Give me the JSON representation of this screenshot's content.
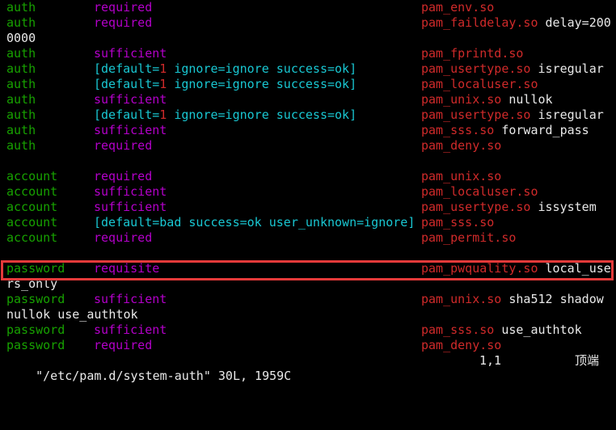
{
  "colors": {
    "type": "#17a100",
    "control": "#b300c9",
    "bracket": "#19c7d2",
    "module": "#cf2a2a",
    "args": "#e9e9e9",
    "highlight": "#e53a3a",
    "background": "#000000"
  },
  "lines": [
    {
      "kind": "rule",
      "type": "auth",
      "control": [
        {
          "t": "required",
          "c": "purple"
        }
      ],
      "module": "pam_env.so",
      "args": ""
    },
    {
      "kind": "rule",
      "type": "auth",
      "control": [
        {
          "t": "required",
          "c": "purple"
        }
      ],
      "module": "pam_faildelay.so",
      "args": " delay=200"
    },
    {
      "kind": "wrap",
      "text": "0000"
    },
    {
      "kind": "rule",
      "type": "auth",
      "control": [
        {
          "t": "sufficient",
          "c": "purple"
        }
      ],
      "module": "pam_fprintd.so",
      "args": ""
    },
    {
      "kind": "rule",
      "type": "auth",
      "control": [
        {
          "t": "[default=",
          "c": "cyan"
        },
        {
          "t": "1",
          "c": "red"
        },
        {
          "t": " ignore=ignore success=ok]",
          "c": "cyan"
        }
      ],
      "module": "pam_usertype.so",
      "args": " isregular"
    },
    {
      "kind": "rule",
      "type": "auth",
      "control": [
        {
          "t": "[default=",
          "c": "cyan"
        },
        {
          "t": "1",
          "c": "red"
        },
        {
          "t": " ignore=ignore success=ok]",
          "c": "cyan"
        }
      ],
      "module": "pam_localuser.so",
      "args": ""
    },
    {
      "kind": "rule",
      "type": "auth",
      "control": [
        {
          "t": "sufficient",
          "c": "purple"
        }
      ],
      "module": "pam_unix.so",
      "args": " nullok"
    },
    {
      "kind": "rule",
      "type": "auth",
      "control": [
        {
          "t": "[default=",
          "c": "cyan"
        },
        {
          "t": "1",
          "c": "red"
        },
        {
          "t": " ignore=ignore success=ok]",
          "c": "cyan"
        }
      ],
      "module": "pam_usertype.so",
      "args": " isregular"
    },
    {
      "kind": "rule",
      "type": "auth",
      "control": [
        {
          "t": "sufficient",
          "c": "purple"
        }
      ],
      "module": "pam_sss.so",
      "args": " forward_pass"
    },
    {
      "kind": "rule",
      "type": "auth",
      "control": [
        {
          "t": "required",
          "c": "purple"
        }
      ],
      "module": "pam_deny.so",
      "args": ""
    },
    {
      "kind": "blank"
    },
    {
      "kind": "rule",
      "type": "account",
      "control": [
        {
          "t": "required",
          "c": "purple"
        }
      ],
      "module": "pam_unix.so",
      "args": ""
    },
    {
      "kind": "rule",
      "type": "account",
      "control": [
        {
          "t": "sufficient",
          "c": "purple"
        }
      ],
      "module": "pam_localuser.so",
      "args": ""
    },
    {
      "kind": "rule",
      "type": "account",
      "control": [
        {
          "t": "sufficient",
          "c": "purple"
        }
      ],
      "module": "pam_usertype.so",
      "args": " issystem"
    },
    {
      "kind": "rule",
      "type": "account",
      "control": [
        {
          "t": "[default=bad success=ok user_unknown=ignore]",
          "c": "cyan"
        }
      ],
      "module": "pam_sss.so",
      "args": ""
    },
    {
      "kind": "rule",
      "type": "account",
      "control": [
        {
          "t": "required",
          "c": "purple"
        }
      ],
      "module": "pam_permit.so",
      "args": ""
    },
    {
      "kind": "blank"
    },
    {
      "kind": "rule",
      "type": "password",
      "control": [
        {
          "t": "requisite",
          "c": "purple"
        }
      ],
      "module": "pam_pwquality.so",
      "args": " local_use"
    },
    {
      "kind": "wrap",
      "text": "rs_only"
    },
    {
      "kind": "rule",
      "type": "password",
      "control": [
        {
          "t": "sufficient",
          "c": "purple"
        }
      ],
      "module": "pam_unix.so",
      "args": " sha512 shadow"
    },
    {
      "kind": "wrap",
      "text": "nullok use_authtok"
    },
    {
      "kind": "rule",
      "type": "password",
      "control": [
        {
          "t": "sufficient",
          "c": "purple"
        }
      ],
      "module": "pam_sss.so",
      "args": " use_authtok"
    },
    {
      "kind": "rule",
      "type": "password",
      "control": [
        {
          "t": "required",
          "c": "purple"
        }
      ],
      "module": "pam_deny.so",
      "args": ""
    }
  ],
  "status": {
    "file": "\"/etc/pam.d/system-auth\" 30L, 1959C",
    "position": "1,1",
    "scroll": "顶端"
  }
}
